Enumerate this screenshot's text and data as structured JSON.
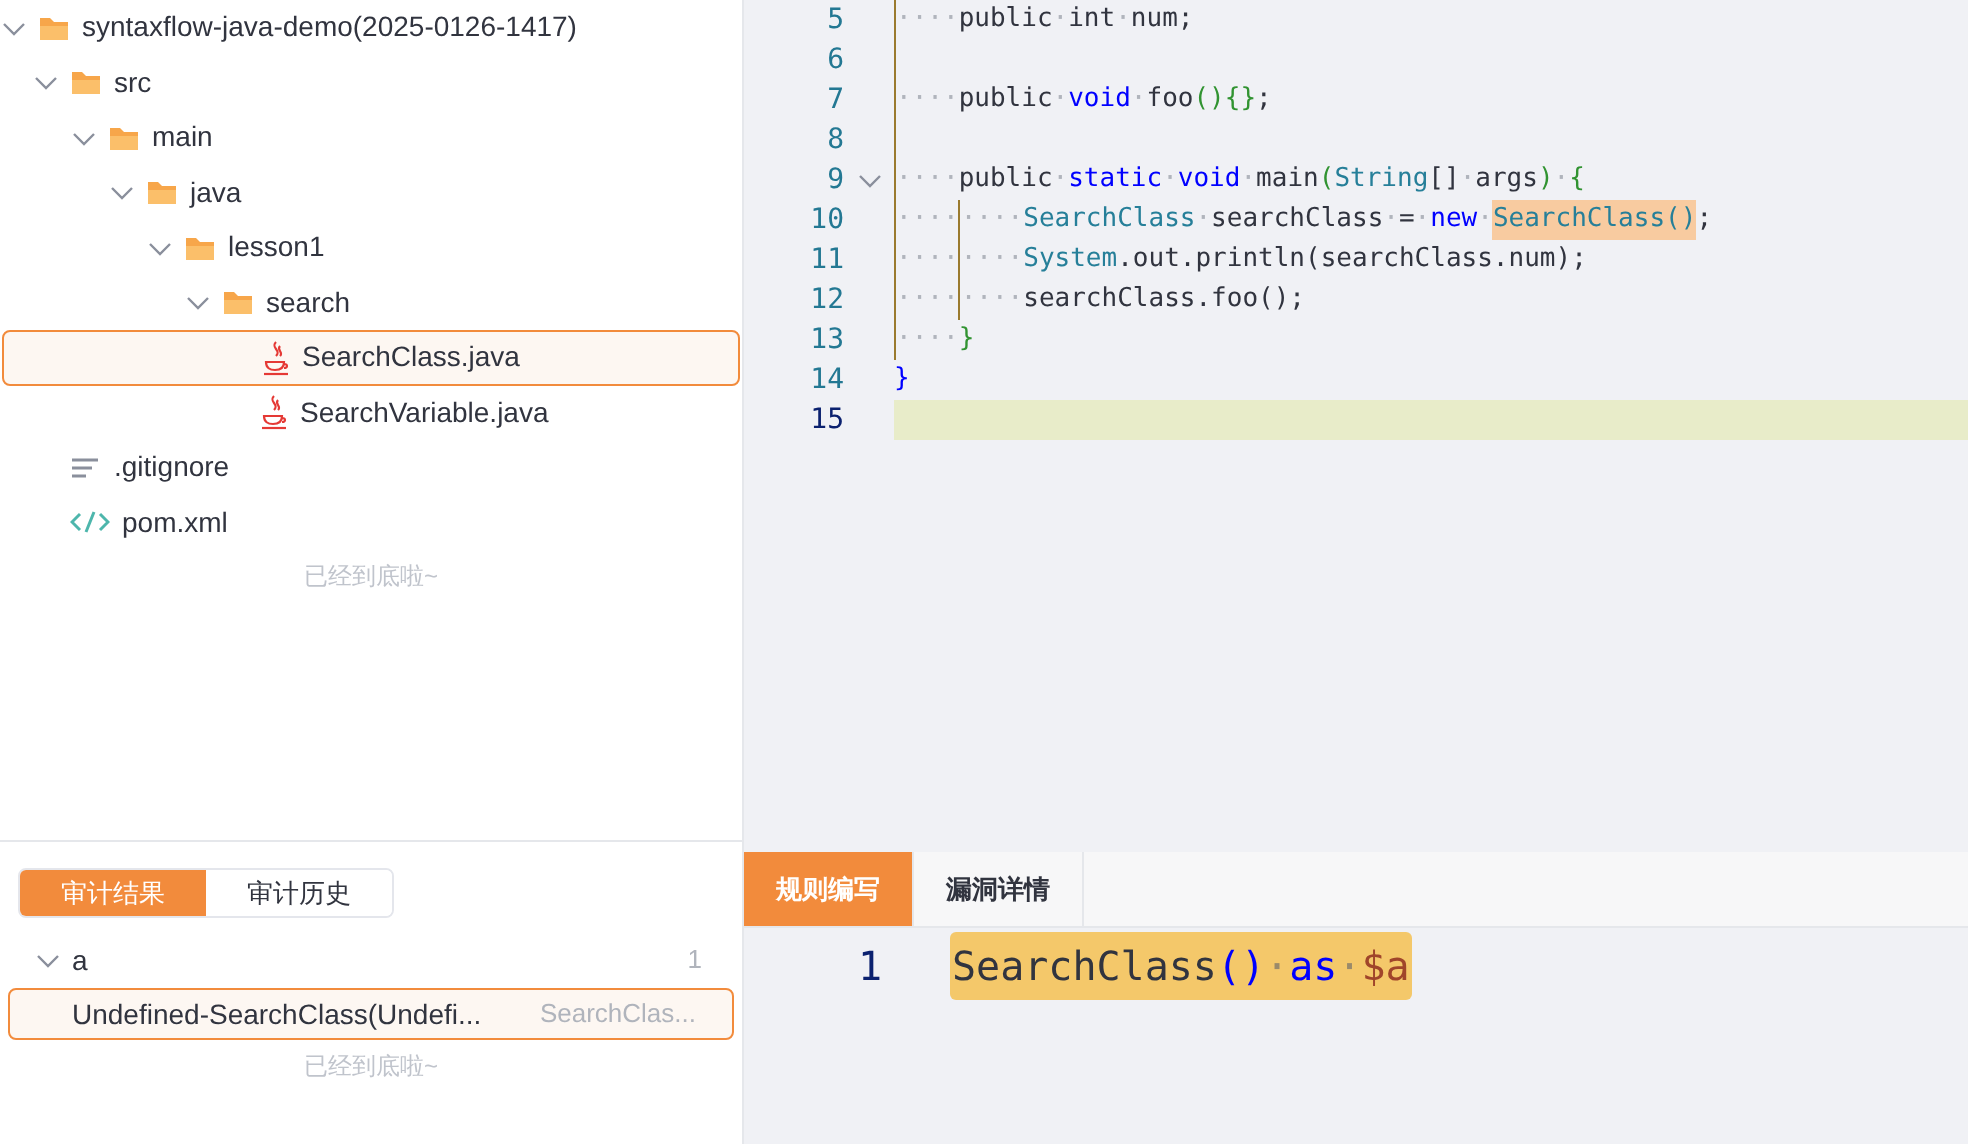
{
  "file_tree": {
    "items": [
      {
        "name": "syntaxflow-java-demo(2025-0126-1417)",
        "kind": "folder",
        "expanded": true,
        "selected": false,
        "children": [
          {
            "name": "src",
            "kind": "folder",
            "expanded": true,
            "selected": false,
            "children": [
              {
                "name": "main",
                "kind": "folder",
                "expanded": true,
                "selected": false,
                "children": [
                  {
                    "name": "java",
                    "kind": "folder",
                    "expanded": true,
                    "selected": false,
                    "children": [
                      {
                        "name": "lesson1",
                        "kind": "folder",
                        "expanded": true,
                        "selected": false,
                        "children": [
                          {
                            "name": "search",
                            "kind": "folder",
                            "expanded": true,
                            "selected": false,
                            "children": [
                              {
                                "name": "SearchClass.java",
                                "kind": "java",
                                "selected": true
                              },
                              {
                                "name": "SearchVariable.java",
                                "kind": "java",
                                "selected": false
                              }
                            ]
                          }
                        ]
                      }
                    ]
                  }
                ]
              }
            ]
          },
          {
            "name": ".gitignore",
            "kind": "text",
            "selected": false
          },
          {
            "name": "pom.xml",
            "kind": "xml",
            "selected": false
          }
        ]
      }
    ],
    "end_note": "已经到底啦~"
  },
  "editor": {
    "lines": [
      {
        "number": "5",
        "fold": false,
        "current": false,
        "tokens": [
          {
            "kind": "guide",
            "t": "····"
          },
          {
            "kind": "plain",
            "t": "public"
          },
          {
            "kind": "ws",
            "t": "·"
          },
          {
            "kind": "plain",
            "t": "int"
          },
          {
            "kind": "ws",
            "t": "·"
          },
          {
            "kind": "plain",
            "t": "num;"
          }
        ]
      },
      {
        "number": "6",
        "fold": false,
        "current": false,
        "tokens": [
          {
            "kind": "guide"
          }
        ]
      },
      {
        "number": "7",
        "fold": false,
        "current": false,
        "tokens": [
          {
            "kind": "guide",
            "t": "····"
          },
          {
            "kind": "plain",
            "t": "public"
          },
          {
            "kind": "ws",
            "t": "·"
          },
          {
            "kind": "keyword",
            "t": "void"
          },
          {
            "kind": "ws",
            "t": "·"
          },
          {
            "kind": "plain",
            "t": "foo"
          },
          {
            "kind": "bracket",
            "t": "(){}"
          },
          {
            "kind": "plain",
            "t": ";"
          }
        ]
      },
      {
        "number": "8",
        "fold": false,
        "current": false,
        "tokens": [
          {
            "kind": "guide"
          }
        ]
      },
      {
        "number": "9",
        "fold": true,
        "current": false,
        "tokens": [
          {
            "kind": "guide",
            "t": "····"
          },
          {
            "kind": "plain",
            "t": "public"
          },
          {
            "kind": "ws",
            "t": "·"
          },
          {
            "kind": "keyword",
            "t": "static"
          },
          {
            "kind": "ws",
            "t": "·"
          },
          {
            "kind": "keyword",
            "t": "void"
          },
          {
            "kind": "ws",
            "t": "·"
          },
          {
            "kind": "plain",
            "t": "main"
          },
          {
            "kind": "bracket",
            "t": "("
          },
          {
            "kind": "type",
            "t": "String"
          },
          {
            "kind": "plain",
            "t": "[]"
          },
          {
            "kind": "ws",
            "t": "·"
          },
          {
            "kind": "plain",
            "t": "args"
          },
          {
            "kind": "bracket",
            "t": ")"
          },
          {
            "kind": "ws",
            "t": "·"
          },
          {
            "kind": "bracket",
            "t": "{"
          }
        ]
      },
      {
        "number": "10",
        "fold": false,
        "current": false,
        "tokens": [
          {
            "kind": "guide",
            "t": "····"
          },
          {
            "kind": "guide",
            "t": "····"
          },
          {
            "kind": "type",
            "t": "SearchClass"
          },
          {
            "kind": "ws",
            "t": "·"
          },
          {
            "kind": "plain",
            "t": "searchClass"
          },
          {
            "kind": "ws",
            "t": "·"
          },
          {
            "kind": "plain",
            "t": "="
          },
          {
            "kind": "ws",
            "t": "·"
          },
          {
            "kind": "keyword",
            "t": "new"
          },
          {
            "kind": "ws",
            "t": "·"
          },
          {
            "kind": "match",
            "t": "SearchClass()"
          },
          {
            "kind": "plain",
            "t": ";"
          }
        ]
      },
      {
        "number": "11",
        "fold": false,
        "current": false,
        "tokens": [
          {
            "kind": "guide",
            "t": "····"
          },
          {
            "kind": "guide",
            "t": "····"
          },
          {
            "kind": "type",
            "t": "System"
          },
          {
            "kind": "plain",
            "t": ".out.println(searchClass.num);"
          }
        ]
      },
      {
        "number": "12",
        "fold": false,
        "current": false,
        "tokens": [
          {
            "kind": "guide",
            "t": "····"
          },
          {
            "kind": "guide",
            "t": "····"
          },
          {
            "kind": "plain",
            "t": "searchClass.foo();"
          }
        ]
      },
      {
        "number": "13",
        "fold": false,
        "current": false,
        "tokens": [
          {
            "kind": "guide",
            "t": "····"
          },
          {
            "kind": "bracket",
            "t": "}"
          }
        ]
      },
      {
        "number": "14",
        "fold": false,
        "current": false,
        "tokens": [
          {
            "kind": "keyword",
            "t": "}"
          }
        ]
      },
      {
        "number": "15",
        "fold": false,
        "current": true
      }
    ]
  },
  "audit_panel": {
    "tabs": [
      {
        "label": "审计结果",
        "selected": true
      },
      {
        "label": "审计历史",
        "selected": false
      }
    ],
    "groups": [
      {
        "name": "a",
        "count": "1",
        "expanded": true,
        "results": [
          {
            "title": "Undefined-SearchClass(Undefi...",
            "path": "SearchClas...",
            "selected": true
          }
        ]
      }
    ],
    "end_note": "已经到底啦~"
  },
  "rule_panel": {
    "tabs": [
      {
        "label": "规则编写",
        "selected": true
      },
      {
        "label": "漏洞详情",
        "selected": false
      }
    ],
    "lines": [
      {
        "number": "1",
        "tokens": [
          {
            "kind": "plain",
            "t": "SearchClass"
          },
          {
            "kind": "keyword",
            "t": "()"
          },
          {
            "kind": "ws",
            "t": "·"
          },
          {
            "kind": "keyword",
            "t": "as"
          },
          {
            "kind": "ws",
            "t": "·"
          },
          {
            "kind": "var",
            "t": "$a"
          }
        ]
      }
    ]
  }
}
